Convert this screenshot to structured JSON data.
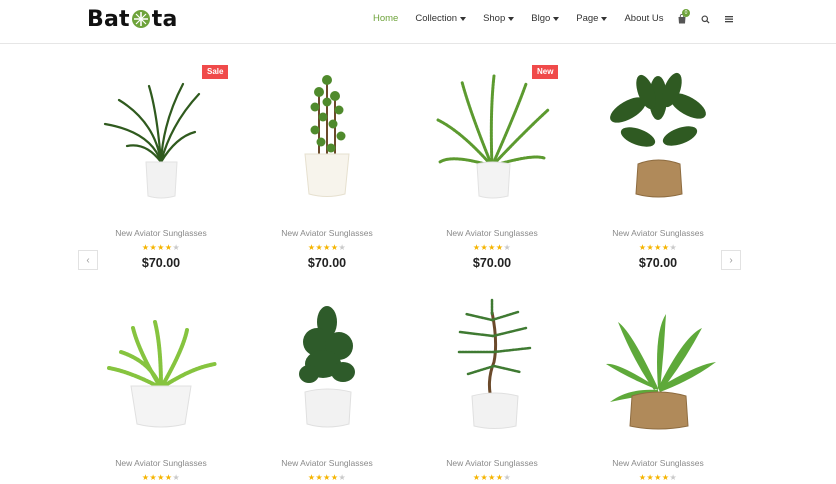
{
  "brand": {
    "logo_left": "Bat",
    "logo_right": "ta"
  },
  "nav": [
    {
      "label": "Home",
      "active": true,
      "dropdown": false
    },
    {
      "label": "Collection",
      "active": false,
      "dropdown": true
    },
    {
      "label": "Shop",
      "active": false,
      "dropdown": true
    },
    {
      "label": "Blgo",
      "active": false,
      "dropdown": true
    },
    {
      "label": "Page",
      "active": false,
      "dropdown": true
    },
    {
      "label": "About Us",
      "active": false,
      "dropdown": false
    }
  ],
  "cart": {
    "count": "0"
  },
  "header_icons": [
    "shopping-bag-icon",
    "search-icon",
    "menu-icon"
  ],
  "carousel": {
    "prev_icon": "chevron-left-icon",
    "next_icon": "chevron-right-icon"
  },
  "products": [
    {
      "name": "New Aviator Sunglasses",
      "rating": 4,
      "price": "$70.00",
      "tag": "Sale",
      "plant": "spiky-plant-white-pot"
    },
    {
      "name": "New Aviator Sunglasses",
      "rating": 4,
      "price": "$70.00",
      "tag": "",
      "plant": "jade-plant-white-pot"
    },
    {
      "name": "New Aviator Sunglasses",
      "rating": 4,
      "price": "$70.00",
      "tag": "New",
      "plant": "fern-white-pot"
    },
    {
      "name": "New Aviator Sunglasses",
      "rating": 4,
      "price": "$70.00",
      "tag": "",
      "plant": "calathea-burlap-pot"
    },
    {
      "name": "New Aviator Sunglasses",
      "rating": 4,
      "price": "",
      "tag": "",
      "plant": "fern-white-bowl"
    },
    {
      "name": "New Aviator Sunglasses",
      "rating": 4,
      "price": "",
      "tag": "",
      "plant": "conifer-white-pot"
    },
    {
      "name": "New Aviator Sunglasses",
      "rating": 4,
      "price": "",
      "tag": "",
      "plant": "araucaria-white-pot"
    },
    {
      "name": "New Aviator Sunglasses",
      "rating": 4,
      "price": "",
      "tag": "",
      "plant": "birds-nest-fern-burlap-pot"
    }
  ],
  "colors": {
    "accent": "#6ea33b",
    "tag": "#f04a4a",
    "star": "#f5b400",
    "star_off": "#c9c9c9"
  }
}
